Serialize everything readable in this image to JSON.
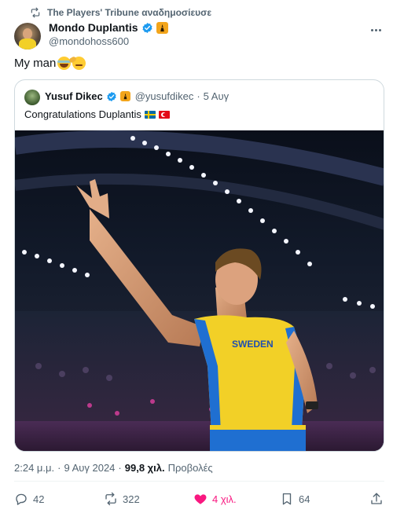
{
  "repost_context": {
    "icon": "repost-icon",
    "text": "The Players' Tribune αναδημοσίευσε"
  },
  "author": {
    "display_name": "Mondo Duplantis",
    "handle": "@mondohoss600",
    "verified": true,
    "affiliation_badge": "flag-badge-icon"
  },
  "tweet": {
    "text": "My man",
    "emojis": [
      "face-with-tears-of-joy",
      "saluting-face"
    ]
  },
  "quoted_tweet": {
    "display_name": "Yusuf Dikec",
    "handle": "@yusufdikec",
    "separator": "·",
    "date": "5 Αυγ",
    "text": "Congratulations Duplantis",
    "flags": [
      "sweden-flag",
      "turkey-flag"
    ],
    "image_text": "SWEDEN"
  },
  "meta": {
    "time": "2:24 μ.μ.",
    "separator": "·",
    "date": "9 Αυγ 2024",
    "separator2": "·",
    "views_count": "99,8 χιλ.",
    "views_label": "Προβολές"
  },
  "actions": {
    "replies": "42",
    "reposts": "322",
    "likes": "4 χιλ.",
    "bookmarks": "64"
  },
  "colors": {
    "like_active": "#f91880",
    "verified": "#1d9bf0",
    "secondary_text": "#536471",
    "jersey_yellow": "#f2d027",
    "jersey_blue": "#1f6fd1"
  }
}
